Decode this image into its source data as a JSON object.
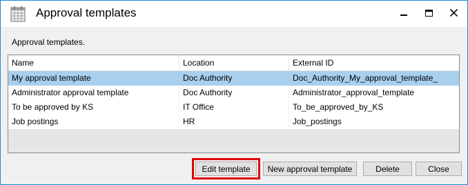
{
  "window": {
    "title": "Approval templates",
    "subtitle": "Approval templates."
  },
  "icons": {
    "app": "calendar-grid-icon",
    "minimize": "minimize-icon",
    "maximize": "maximize-icon",
    "close": "close-icon"
  },
  "grid": {
    "columns": [
      "Name",
      "Location",
      "External ID"
    ],
    "rows": [
      {
        "name": "My approval template",
        "location": "Doc Authority",
        "external_id": "Doc_Authority_My_approval_template_",
        "selected": true
      },
      {
        "name": "Administrator approval template",
        "location": "Doc Authority",
        "external_id": "Administrator_approval_template",
        "selected": false
      },
      {
        "name": "To be approved by KS",
        "location": "IT Office",
        "external_id": "To_be_approved_by_KS",
        "selected": false
      },
      {
        "name": "Job postings",
        "location": "HR",
        "external_id": "Job_postings",
        "selected": false
      }
    ]
  },
  "buttons": {
    "edit": "Edit template",
    "new": "New approval template",
    "delete": "Delete",
    "close": "Close"
  },
  "colors": {
    "accent_border": "#1a8ad4",
    "selection": "#a8cfee",
    "highlight": "#e00000"
  }
}
